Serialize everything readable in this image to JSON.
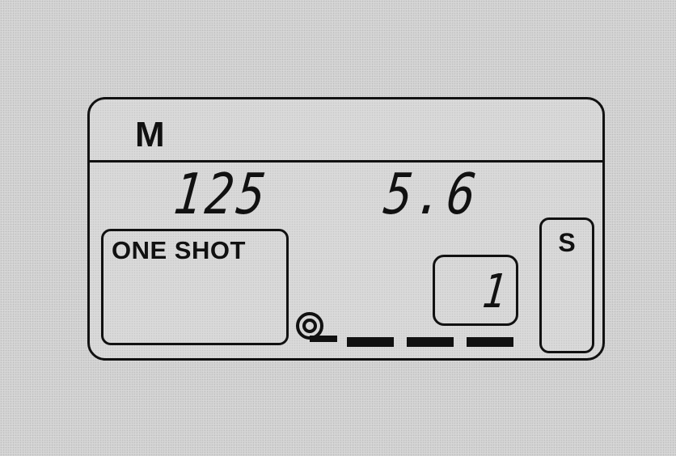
{
  "display": {
    "exposure_mode": "M",
    "shutter_speed": "125",
    "aperture": "5.6",
    "af_mode": "ONE SHOT",
    "frame_counter": "1",
    "drive_mode": "S",
    "film_load_segments": 3,
    "film_cassette_icon": "film-cassette-icon"
  }
}
